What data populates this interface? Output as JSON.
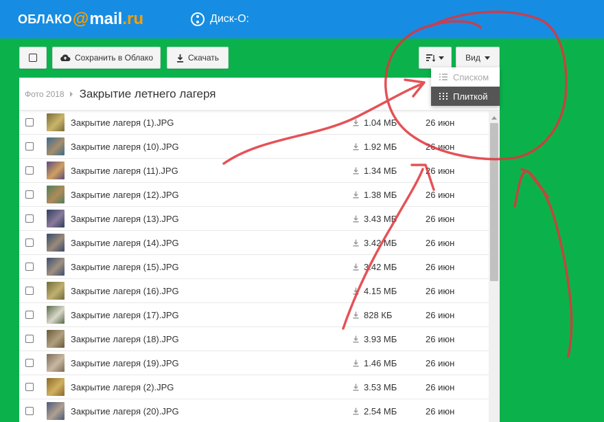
{
  "header": {
    "logo_part1": "ОБЛАКО",
    "logo_at": "@",
    "logo_part2": "mail",
    "logo_part3": ".ru",
    "disk_label": "Диск-О:"
  },
  "toolbar": {
    "save_label": "Сохранить в Облако",
    "download_label": "Скачать",
    "view_label": "Вид"
  },
  "view_menu": {
    "items": [
      {
        "label": "Списком",
        "active": false
      },
      {
        "label": "Плиткой",
        "active": true
      }
    ]
  },
  "breadcrumb": {
    "parent": "Фото 2018",
    "current": "Закрытие летнего лагеря"
  },
  "files": [
    {
      "name": "Закрытие лагеря (1).JPG",
      "size": "1.04 МБ",
      "date": "26 июн"
    },
    {
      "name": "Закрытие лагеря (10).JPG",
      "size": "1.92 МБ",
      "date": "26 июн"
    },
    {
      "name": "Закрытие лагеря (11).JPG",
      "size": "1.34 МБ",
      "date": "26 июн"
    },
    {
      "name": "Закрытие лагеря (12).JPG",
      "size": "1.38 МБ",
      "date": "26 июн"
    },
    {
      "name": "Закрытие лагеря (13).JPG",
      "size": "3.43 МБ",
      "date": "26 июн"
    },
    {
      "name": "Закрытие лагеря (14).JPG",
      "size": "3.42 МБ",
      "date": "26 июн"
    },
    {
      "name": "Закрытие лагеря (15).JPG",
      "size": "3.42 МБ",
      "date": "26 июн"
    },
    {
      "name": "Закрытие лагеря (16).JPG",
      "size": "4.15 МБ",
      "date": "26 июн"
    },
    {
      "name": "Закрытие лагеря (17).JPG",
      "size": "828 КБ",
      "date": "26 июн"
    },
    {
      "name": "Закрытие лагеря (18).JPG",
      "size": "3.93 МБ",
      "date": "26 июн"
    },
    {
      "name": "Закрытие лагеря (19).JPG",
      "size": "1.46 МБ",
      "date": "26 июн"
    },
    {
      "name": "Закрытие лагеря (2).JPG",
      "size": "3.53 МБ",
      "date": "26 июн"
    },
    {
      "name": "Закрытие лагеря (20).JPG",
      "size": "2.54 МБ",
      "date": "26 июн"
    }
  ],
  "colors": {
    "header_bg": "#168de2",
    "page_bg": "#0bb24c",
    "logo_accent": "#ff9e00",
    "annotation": "#e0343a"
  }
}
